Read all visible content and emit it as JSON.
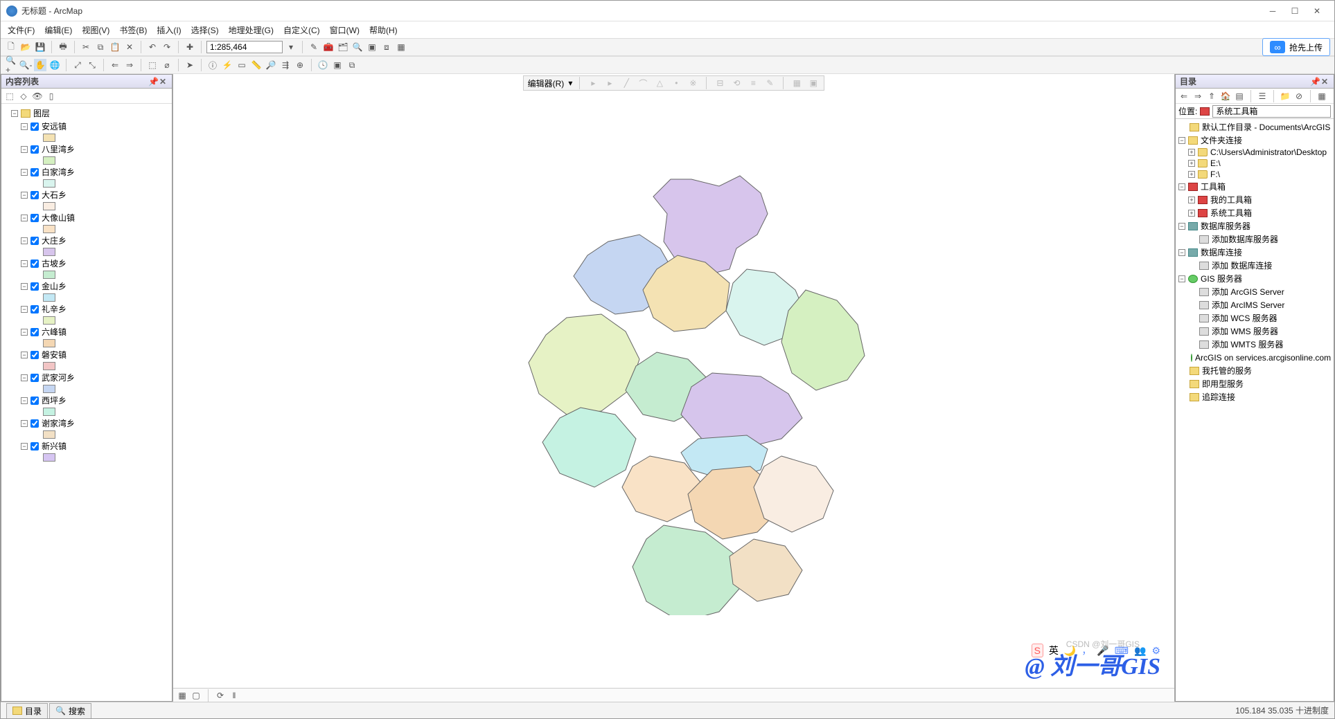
{
  "title": "无标题 - ArcMap",
  "menu": [
    "文件(F)",
    "编辑(E)",
    "视图(V)",
    "书签(B)",
    "插入(I)",
    "选择(S)",
    "地理处理(G)",
    "自定义(C)",
    "窗口(W)",
    "帮助(H)"
  ],
  "cloud_btn": "抢先上传",
  "scale": "1:285,464",
  "editor_label": "编辑器(R)",
  "toc": {
    "title": "内容列表",
    "root": "图层",
    "layers": [
      {
        "name": "安远镇",
        "color": "#f4e2b3"
      },
      {
        "name": "八里湾乡",
        "color": "#d5f0c1"
      },
      {
        "name": "白家湾乡",
        "color": "#d9f4ee"
      },
      {
        "name": "大石乡",
        "color": "#f9ede2"
      },
      {
        "name": "大像山镇",
        "color": "#f9e2c6"
      },
      {
        "name": "大庄乡",
        "color": "#d7c5ec"
      },
      {
        "name": "古坡乡",
        "color": "#c5ecd0"
      },
      {
        "name": "金山乡",
        "color": "#c3e8f4"
      },
      {
        "name": "礼辛乡",
        "color": "#e6f2c5"
      },
      {
        "name": "六峰镇",
        "color": "#f4d7b3"
      },
      {
        "name": "磐安镇",
        "color": "#f2c5c5"
      },
      {
        "name": "武家河乡",
        "color": "#c5d6f2"
      },
      {
        "name": "西坪乡",
        "color": "#c5f2e2"
      },
      {
        "name": "谢家湾乡",
        "color": "#f2e0c5"
      },
      {
        "name": "新兴镇",
        "color": "#d6c5f2"
      }
    ]
  },
  "catalog": {
    "title": "目录",
    "location_label": "位置:",
    "location_value": "系统工具箱",
    "nodes": [
      {
        "ind": 0,
        "ico": "fy",
        "label": "默认工作目录 - Documents\\ArcGIS"
      },
      {
        "ind": 0,
        "ico": "fy",
        "label": "文件夹连接",
        "exp": "-"
      },
      {
        "ind": 1,
        "ico": "fd",
        "label": "C:\\Users\\Administrator\\Desktop",
        "exp": "+"
      },
      {
        "ind": 1,
        "ico": "fd",
        "label": "E:\\",
        "exp": "+"
      },
      {
        "ind": 1,
        "ico": "fd",
        "label": "F:\\",
        "exp": "+"
      },
      {
        "ind": 0,
        "ico": "tb",
        "label": "工具箱",
        "exp": "-"
      },
      {
        "ind": 1,
        "ico": "tb",
        "label": "我的工具箱",
        "exp": "+"
      },
      {
        "ind": 1,
        "ico": "tb",
        "label": "系统工具箱",
        "exp": "+"
      },
      {
        "ind": 0,
        "ico": "db",
        "label": "数据库服务器",
        "exp": "-"
      },
      {
        "ind": 1,
        "ico": "sv",
        "label": "添加数据库服务器"
      },
      {
        "ind": 0,
        "ico": "db",
        "label": "数据库连接",
        "exp": "-"
      },
      {
        "ind": 1,
        "ico": "sv",
        "label": "添加 数据库连接"
      },
      {
        "ind": 0,
        "ico": "gl",
        "label": "GIS 服务器",
        "exp": "-"
      },
      {
        "ind": 1,
        "ico": "sv",
        "label": "添加 ArcGIS Server"
      },
      {
        "ind": 1,
        "ico": "sv",
        "label": "添加 ArcIMS Server"
      },
      {
        "ind": 1,
        "ico": "sv",
        "label": "添加 WCS 服务器"
      },
      {
        "ind": 1,
        "ico": "sv",
        "label": "添加 WMS 服务器"
      },
      {
        "ind": 1,
        "ico": "sv",
        "label": "添加 WMTS 服务器"
      },
      {
        "ind": 1,
        "ico": "gl",
        "label": "ArcGIS on services.arcgisonline.com (用户)"
      },
      {
        "ind": 0,
        "ico": "fy",
        "label": "我托管的服务"
      },
      {
        "ind": 0,
        "ico": "fy",
        "label": "即用型服务"
      },
      {
        "ind": 0,
        "ico": "fy",
        "label": "追踪连接"
      }
    ]
  },
  "status": {
    "tab1": "目录",
    "tab2": "搜索",
    "coords": "105.184  35.035 十进制度"
  },
  "watermark": "@ 刘一哥GIS",
  "csdn": "CSDN @刘一哥GIS",
  "tray_ime": "英"
}
